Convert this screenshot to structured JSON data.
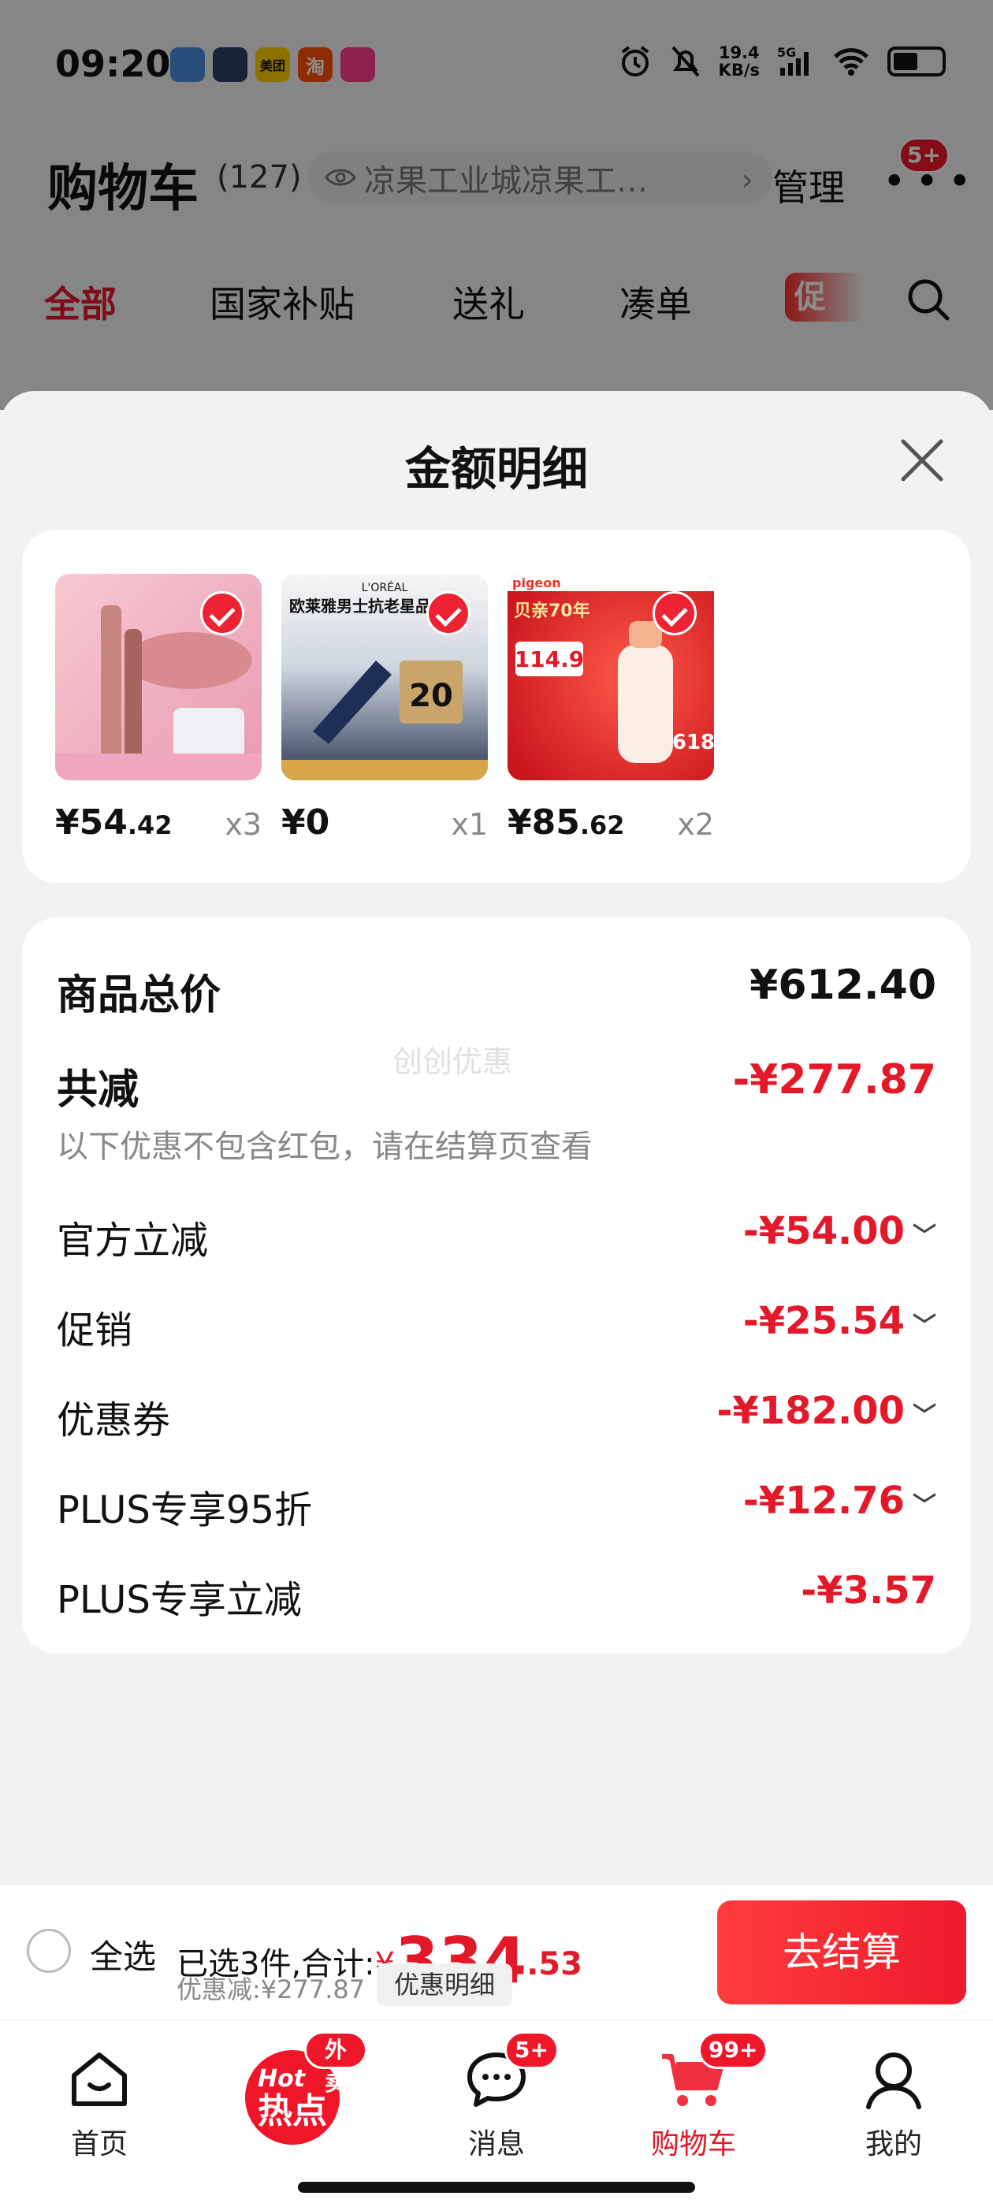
{
  "status_bar": {
    "time": "09:20",
    "net_speed": "19.4",
    "net_unit": "KB/s",
    "signal": "5G",
    "notification_apps": [
      {
        "name": "app-icon-1",
        "color": "#4a90e2",
        "label": ""
      },
      {
        "name": "app-icon-2",
        "color": "#2c3e66",
        "label": ""
      },
      {
        "name": "meituan-icon",
        "color": "#ffd100",
        "label": "美团"
      },
      {
        "name": "taobao-icon",
        "color": "#ff5000",
        "label": "淘"
      },
      {
        "name": "app-icon-5",
        "color": "#ff3d8b",
        "label": ""
      }
    ]
  },
  "cart_header": {
    "title": "购物车",
    "count": "(127)",
    "address": "凉果工业城凉果工…",
    "manage": "管理",
    "more_badge": "5+"
  },
  "filter_tabs": [
    {
      "label": "全部",
      "active": true
    },
    {
      "label": "国家补贴",
      "active": false
    },
    {
      "label": "送礼",
      "active": false
    },
    {
      "label": "凑单",
      "active": false
    }
  ],
  "promo_tag": "促",
  "sheet": {
    "title": "金额明细",
    "products": [
      {
        "price_int": "¥54",
        "price_dec": ".42",
        "qty": "x3",
        "image": "lip-gloss-product"
      },
      {
        "price_int": "¥0",
        "price_dec": "",
        "qty": "x1",
        "image": "loreal-eye-cream-product"
      },
      {
        "price_int": "¥85",
        "price_dec": ".62",
        "qty": "x2",
        "image": "pigeon-bottle-product"
      }
    ],
    "product_image_text": {
      "p2_brand": "L'ORÉAL",
      "p2_headline": "欧莱雅男士抗老星品",
      "p2_coupon": "20",
      "p3_brand": "pigeon",
      "p3_headline": "贝亲70年",
      "p3_price": "114.9",
      "p3_tag": "618"
    },
    "total_label": "商品总价",
    "total_value": "¥612.40",
    "reduce_label": "共减",
    "reduce_value": "-¥277.87",
    "note": "以下优惠不包含红包，请在结算页查看",
    "watermark": "创创优惠",
    "discounts": [
      {
        "label": "官方立减",
        "value": "-¥54.00",
        "expandable": true
      },
      {
        "label": "促销",
        "value": "-¥25.54",
        "expandable": true
      },
      {
        "label": "优惠券",
        "value": "-¥182.00",
        "expandable": true
      },
      {
        "label": "PLUS专享95折",
        "value": "-¥12.76",
        "expandable": true
      },
      {
        "label": "PLUS专享立减",
        "value": "-¥3.57",
        "expandable": false
      }
    ]
  },
  "settle_bar": {
    "select_all": "全选",
    "summary_prefix": "已选3件,合计:",
    "currency": "¥",
    "amount_int": "334",
    "amount_dec": ".53",
    "discount_text": "优惠减:¥277.87",
    "detail_button": "优惠明细",
    "checkout": "去结算"
  },
  "tab_bar": [
    {
      "label": "首页",
      "icon": "home-icon",
      "badge": ""
    },
    {
      "label": "",
      "icon": "hot-icon",
      "badge": "外卖",
      "hot_top": "Hot",
      "hot_main": "热点"
    },
    {
      "label": "消息",
      "icon": "message-icon",
      "badge": "5+"
    },
    {
      "label": "购物车",
      "icon": "cart-icon",
      "badge": "99+",
      "active": true
    },
    {
      "label": "我的",
      "icon": "profile-icon",
      "badge": ""
    }
  ],
  "colors": {
    "accent": "#e3192a",
    "sheet_bg": "#f2f2f4"
  }
}
